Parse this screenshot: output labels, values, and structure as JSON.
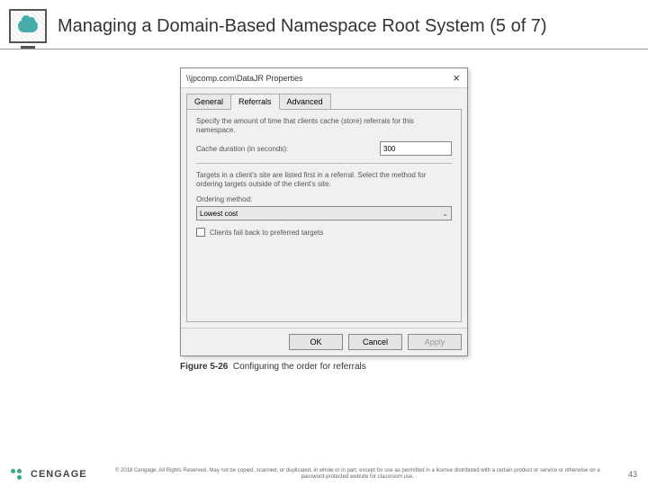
{
  "slide": {
    "title": "Managing a Domain-Based Namespace Root System (5 of 7)",
    "page_number": "43"
  },
  "dialog": {
    "title": "\\\\jpcomp.com\\DataJR Properties",
    "tabs": {
      "general": "General",
      "referrals": "Referrals",
      "advanced": "Advanced"
    },
    "section1_desc": "Specify the amount of time that clients cache (store) referrals for this namespace.",
    "cache_label": "Cache duration (in seconds):",
    "cache_value": "300",
    "section2_desc": "Targets in a client's site are listed first in a referral. Select the method for ordering targets outside of the client's site.",
    "ordering_label": "Ordering method:",
    "ordering_value": "Lowest cost",
    "checkbox_label": "Clients fail back to preferred targets",
    "buttons": {
      "ok": "OK",
      "cancel": "Cancel",
      "apply": "Apply"
    }
  },
  "caption": {
    "label": "Figure 5-26",
    "text": "Configuring the order for referrals"
  },
  "footer": {
    "brand": "CENGAGE",
    "copyright": "© 2018 Cengage. All Rights Reserved. May not be copied, scanned, or duplicated, in whole or in part, except for use as permitted in a license distributed with a certain product or service or otherwise on a password-protected website for classroom use."
  }
}
